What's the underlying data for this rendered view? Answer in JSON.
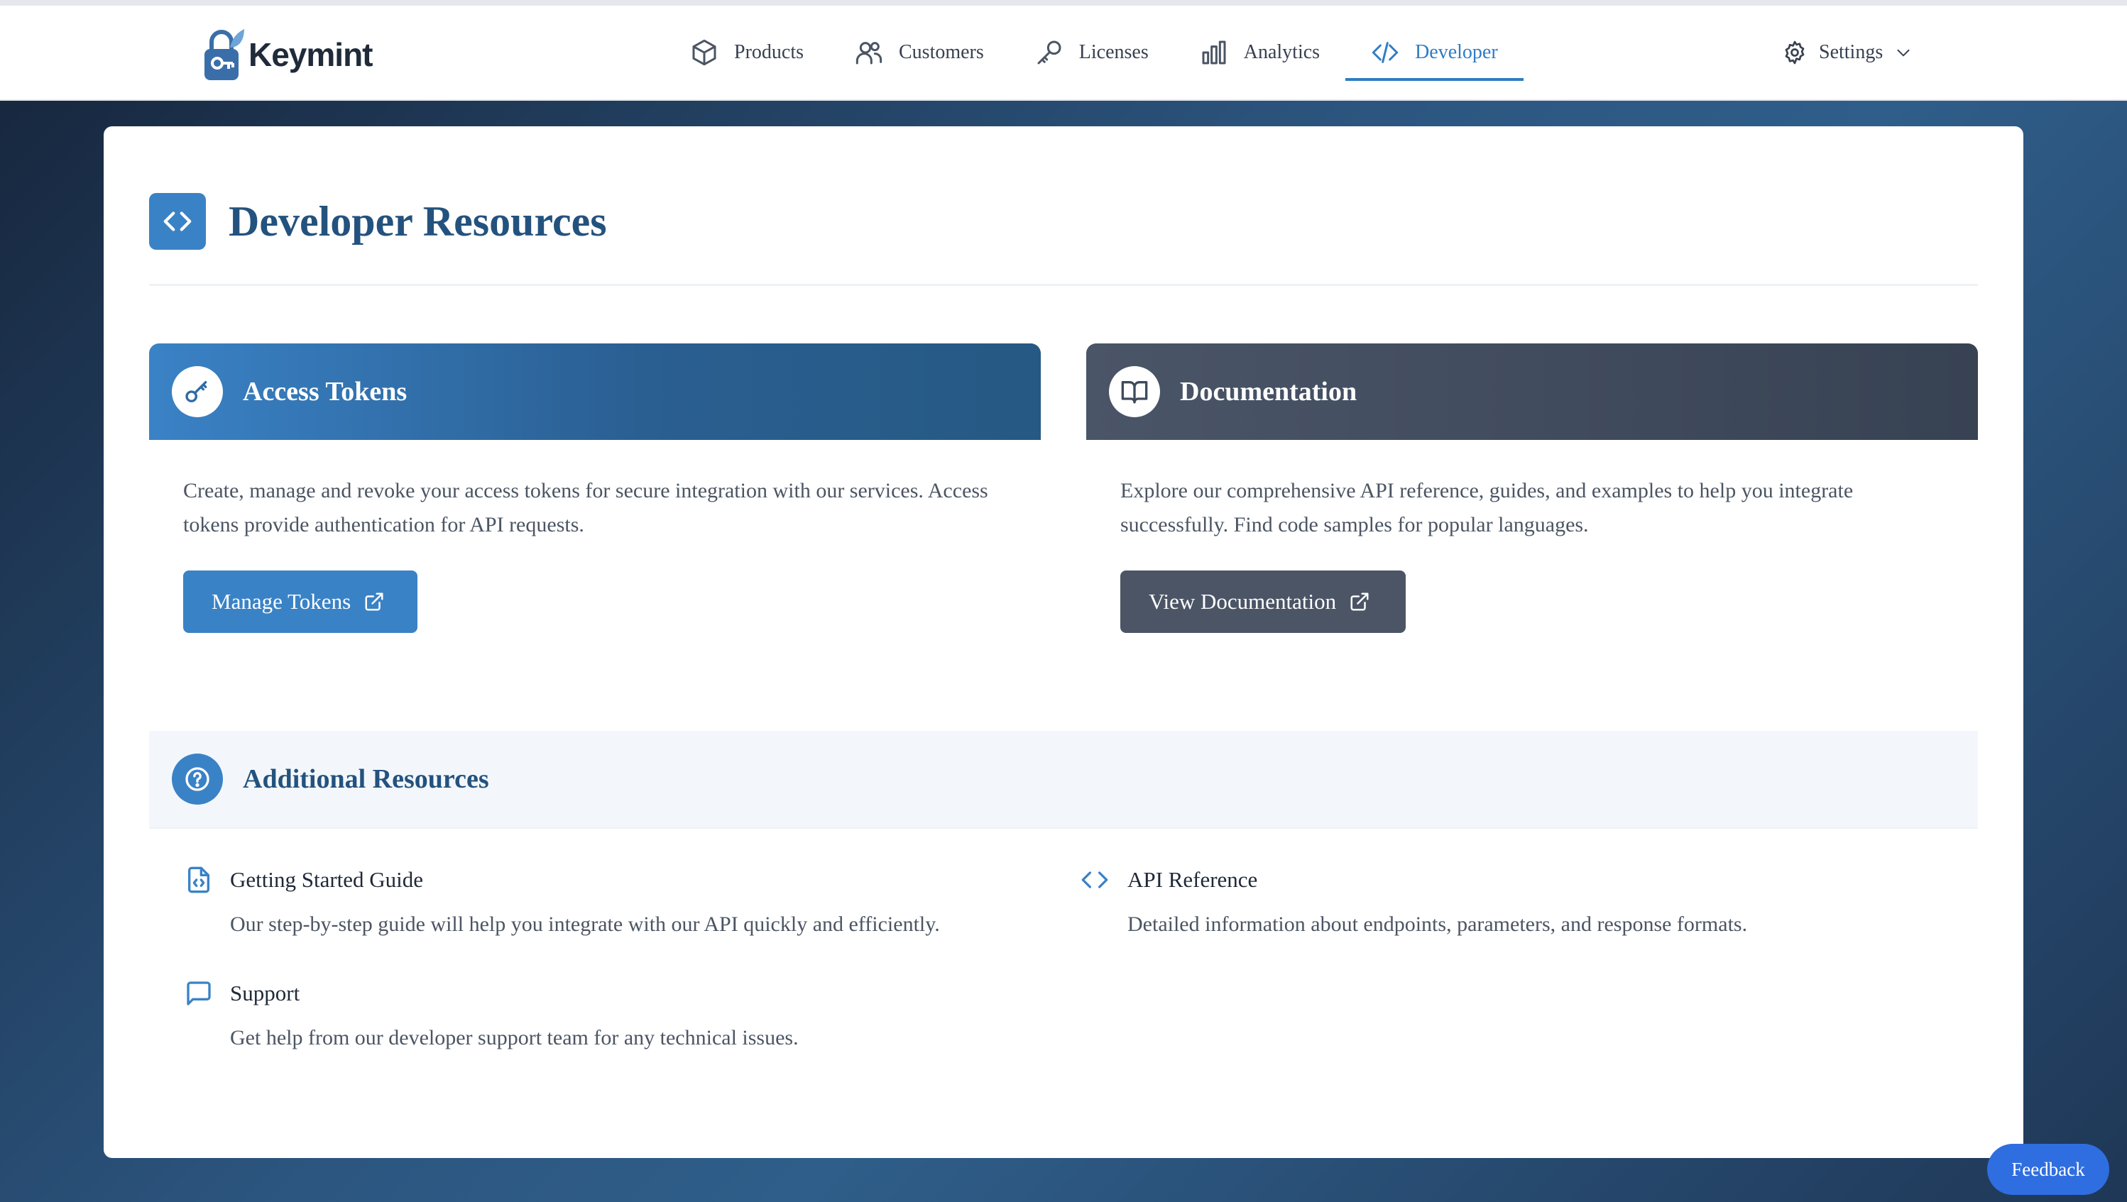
{
  "app": {
    "name": "Keymint"
  },
  "nav": {
    "items": [
      {
        "label": "Products",
        "icon": "box-icon"
      },
      {
        "label": "Customers",
        "icon": "users-icon"
      },
      {
        "label": "Licenses",
        "icon": "key-icon"
      },
      {
        "label": "Analytics",
        "icon": "bar-chart-icon"
      },
      {
        "label": "Developer",
        "icon": "code-icon",
        "active": true
      }
    ],
    "settings_label": "Settings"
  },
  "page": {
    "title": "Developer Resources"
  },
  "panels": {
    "tokens": {
      "title": "Access Tokens",
      "description": "Create, manage and revoke your access tokens for secure integration with our services. Access tokens provide authentication for API requests.",
      "button_label": "Manage Tokens"
    },
    "docs": {
      "title": "Documentation",
      "description": "Explore our comprehensive API reference, guides, and examples to help you integrate successfully. Find code samples for popular languages.",
      "button_label": "View Documentation"
    }
  },
  "additional": {
    "title": "Additional Resources",
    "items": [
      {
        "title": "Getting Started Guide",
        "description": "Our step-by-step guide will help you integrate with our API quickly and efficiently.",
        "icon": "file-code-icon"
      },
      {
        "title": "API Reference",
        "description": "Detailed information about endpoints, parameters, and response formats.",
        "icon": "code-brackets-icon"
      },
      {
        "title": "Support",
        "description": "Get help from our developer support team for any technical issues.",
        "icon": "chat-icon"
      }
    ]
  },
  "feedback_label": "Feedback",
  "colors": {
    "accent": "#3a82c6",
    "heading": "#24527e",
    "dark_panel": "#3f4a5c",
    "feedback": "#2f6ee0"
  }
}
